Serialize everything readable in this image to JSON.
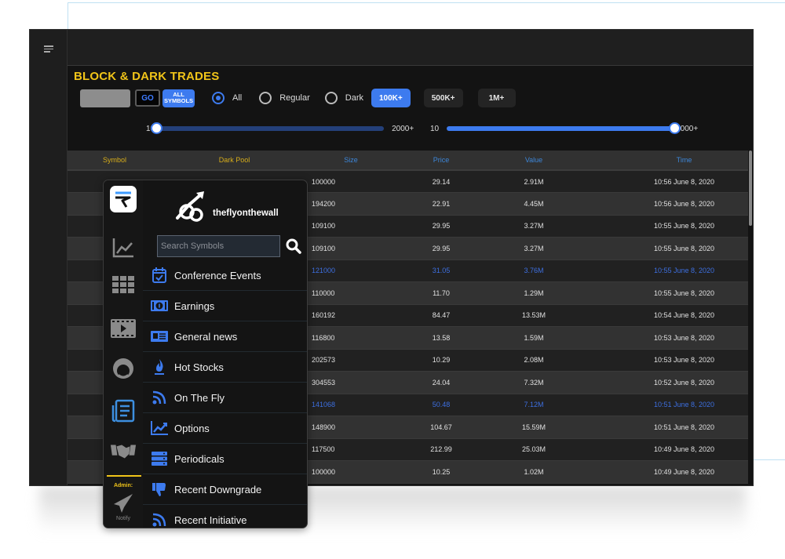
{
  "app": {
    "menu_icon": "hamburger-icon"
  },
  "page": {
    "title": "BLOCK & DARK TRADES"
  },
  "filters": {
    "symbol_input_value": "",
    "go_label": "GO",
    "all_symbols_label_line1": "ALL",
    "all_symbols_label_line2": "SYMBOLS",
    "radios": [
      {
        "label": "All",
        "checked": true
      },
      {
        "label": "Regular",
        "checked": false
      },
      {
        "label": "Dark",
        "checked": false
      }
    ],
    "size_buttons": [
      {
        "label": "100K+",
        "active": true
      },
      {
        "label": "500K+",
        "active": false
      },
      {
        "label": "1M+",
        "active": false
      }
    ],
    "slider1": {
      "min_label": "10",
      "max_label": "2000+",
      "value_fraction": 0.0
    },
    "slider2": {
      "min_label": "10",
      "max_label": "2000+",
      "value_fraction": 1.0
    }
  },
  "table": {
    "columns": [
      "Symbol",
      "Dark Pool",
      "Size",
      "Price",
      "Value",
      "Time"
    ],
    "rows": [
      {
        "symbol": "",
        "dark_pool": "",
        "size": "100000",
        "price": "29.14",
        "value": "2.91M",
        "time": "10:56 June 8, 2020",
        "highlight": false
      },
      {
        "symbol": "",
        "dark_pool": "",
        "size": "194200",
        "price": "22.91",
        "value": "4.45M",
        "time": "10:56 June 8, 2020",
        "highlight": false
      },
      {
        "symbol": "",
        "dark_pool": "",
        "size": "109100",
        "price": "29.95",
        "value": "3.27M",
        "time": "10:55 June 8, 2020",
        "highlight": false
      },
      {
        "symbol": "",
        "dark_pool": "",
        "size": "109100",
        "price": "29.95",
        "value": "3.27M",
        "time": "10:55 June 8, 2020",
        "highlight": false
      },
      {
        "symbol": "",
        "dark_pool": "",
        "size": "121000",
        "price": "31.05",
        "value": "3.76M",
        "time": "10:55 June 8, 2020",
        "highlight": true
      },
      {
        "symbol": "",
        "dark_pool": "",
        "size": "110000",
        "price": "11.70",
        "value": "1.29M",
        "time": "10:55 June 8, 2020",
        "highlight": false
      },
      {
        "symbol": "",
        "dark_pool": "",
        "size": "160192",
        "price": "84.47",
        "value": "13.53M",
        "time": "10:54 June 8, 2020",
        "highlight": false
      },
      {
        "symbol": "",
        "dark_pool": "",
        "size": "116800",
        "price": "13.58",
        "value": "1.59M",
        "time": "10:53 June 8, 2020",
        "highlight": false
      },
      {
        "symbol": "",
        "dark_pool": "",
        "size": "202573",
        "price": "10.29",
        "value": "2.08M",
        "time": "10:53 June 8, 2020",
        "highlight": false
      },
      {
        "symbol": "",
        "dark_pool": "",
        "size": "304553",
        "price": "24.04",
        "value": "7.32M",
        "time": "10:52 June 8, 2020",
        "highlight": false
      },
      {
        "symbol": "",
        "dark_pool": "",
        "size": "141068",
        "price": "50.48",
        "value": "7.12M",
        "time": "10:51 June 8, 2020",
        "highlight": true
      },
      {
        "symbol": "",
        "dark_pool": "",
        "size": "148900",
        "price": "104.67",
        "value": "15.59M",
        "time": "10:51 June 8, 2020",
        "highlight": false
      },
      {
        "symbol": "",
        "dark_pool": "",
        "size": "117500",
        "price": "212.99",
        "value": "25.03M",
        "time": "10:49 June 8, 2020",
        "highlight": false
      },
      {
        "symbol": "",
        "dark_pool": "",
        "size": "100000",
        "price": "10.25",
        "value": "1.02M",
        "time": "10:49 June 8, 2020",
        "highlight": false
      }
    ]
  },
  "overlay": {
    "brand_name": "theflyonthewall",
    "search_placeholder": "Search Symbols",
    "rail_icons": [
      "chart-line-icon",
      "grid-icon",
      "video-icon",
      "headset-icon",
      "news-list-icon",
      "handshake-icon"
    ],
    "admin_label": "Admin:",
    "notify_label": "Notify",
    "menu_items": [
      {
        "label": "Conference Events",
        "icon": "calendar-check-icon"
      },
      {
        "label": "Earnings",
        "icon": "money-icon"
      },
      {
        "label": "General news",
        "icon": "newspaper-icon"
      },
      {
        "label": "Hot Stocks",
        "icon": "flame-icon"
      },
      {
        "label": "On The Fly",
        "icon": "rss-icon"
      },
      {
        "label": "Options",
        "icon": "chart-area-icon"
      },
      {
        "label": "Periodicals",
        "icon": "server-icon"
      },
      {
        "label": "Recent Downgrade",
        "icon": "thumbs-down-icon"
      },
      {
        "label": "Recent Initiative",
        "icon": "rss-icon"
      }
    ]
  },
  "colors": {
    "accent_blue": "#3d7bef",
    "title_yellow": "#f0c419",
    "header_yellow": "#d7ad1a",
    "header_blue": "#3d86d8",
    "highlight_row": "#3d6fe0"
  }
}
